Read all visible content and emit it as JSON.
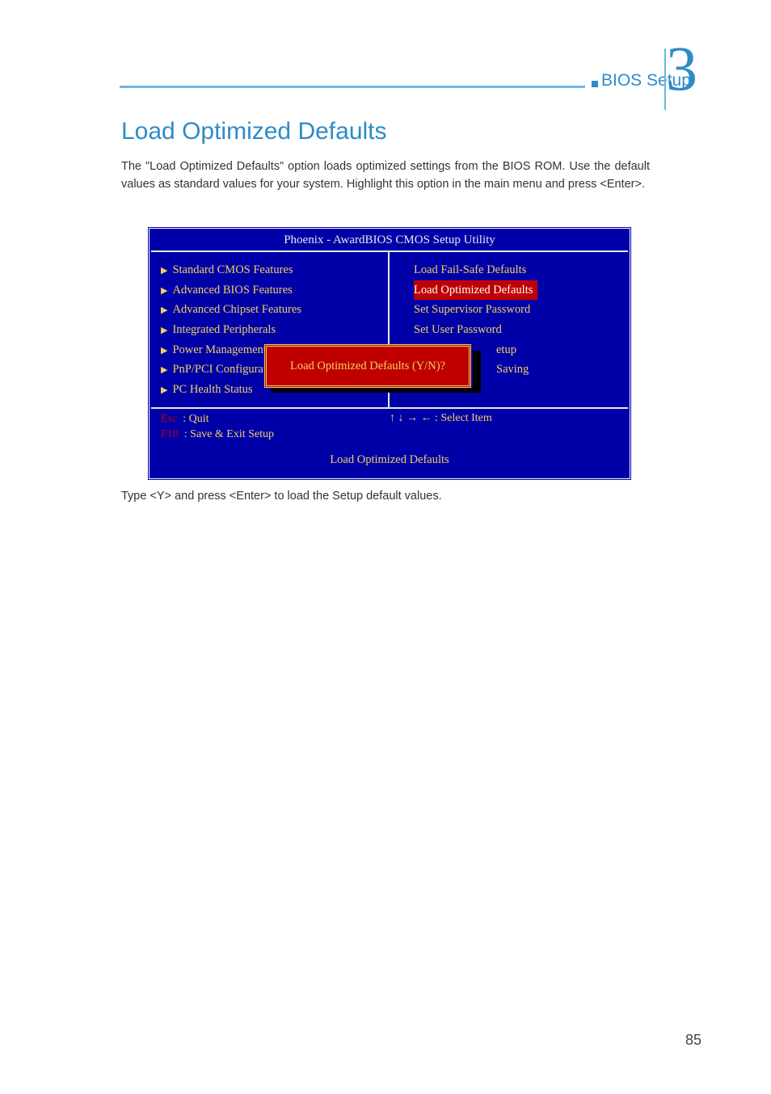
{
  "header": {
    "section": "BIOS Setup",
    "chapter_number": "3"
  },
  "heading": "Load Optimized Defaults",
  "body": "The \"Load Optimized Defaults\" option loads optimized settings from the BIOS ROM. Use the default values as standard values for your system. Highlight this option in the main menu and press <Enter>.",
  "bios": {
    "title": "Phoenix - AwardBIOS CMOS Setup Utility",
    "left_items": [
      "Standard CMOS Features",
      "Advanced BIOS Features",
      "Advanced Chipset Features",
      "Integrated Peripherals",
      "Power Management",
      "PnP/PCI Configurat",
      "PC Health Status"
    ],
    "right_items_plain": [
      "Load Fail-Safe Defaults"
    ],
    "right_item_selected": "Load Optimized Defaults",
    "right_items_after": [
      "Set Supervisor Password",
      "Set User Password"
    ],
    "right_fragment_1": "etup",
    "right_fragment_2": "Saving",
    "prompt": "Load Optimized Defaults (Y/N)?",
    "footer_left_line1_key": "Esc",
    "footer_left_line1_label": ":   Quit",
    "footer_left_line2_key": "F10",
    "footer_left_line2_label": ":   Save & Exit Setup",
    "footer_right": "↑ ↓ → ← : Select Item",
    "footer_description": "Load Optimized Defaults"
  },
  "post_text": "Type <Y> and press <Enter> to load the Setup default values.",
  "page_number": "85"
}
